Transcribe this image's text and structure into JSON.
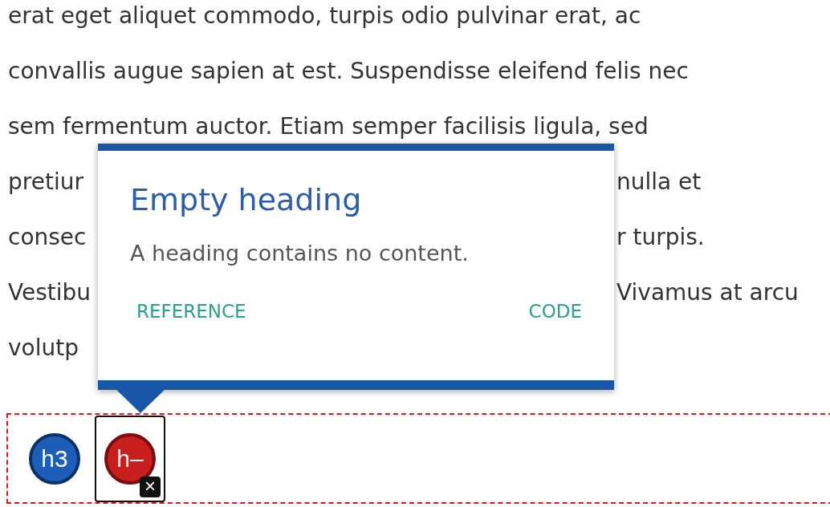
{
  "paragraph_lines": [
    {
      "left": "erat eget aliquet commodo, turpis odio pulvinar erat, ac"
    },
    {
      "left": "convallis augue sapien at est. Suspendisse eleifend felis nec"
    },
    {
      "left": "sem fermentum auctor. Etiam semper facilisis ligula, sed"
    },
    {
      "left": "pretiur",
      "right": "nulla et"
    },
    {
      "left": "consec",
      "right": "r turpis."
    },
    {
      "left": "Vestibu",
      "right": "Vivamus at arcu"
    },
    {
      "left": "volutp"
    }
  ],
  "popup": {
    "title": "Empty heading",
    "message": "A heading contains no content.",
    "links": [
      "REFERENCE",
      "CODE"
    ]
  },
  "markers": [
    {
      "kind": "ok",
      "label": "h3",
      "selected": false
    },
    {
      "kind": "error",
      "label": "h–",
      "selected": true,
      "badge": "×"
    }
  ]
}
